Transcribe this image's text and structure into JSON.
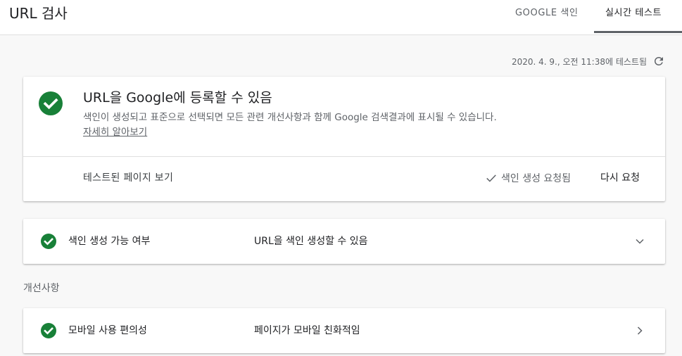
{
  "header": {
    "title": "URL 검사",
    "tabs": [
      {
        "label": "GOOGLE 색인",
        "active": false
      },
      {
        "label": "실시간 테스트",
        "active": true
      }
    ]
  },
  "test_info": {
    "timestamp": "2020. 4. 9., 오전 11:38에 테스트됨",
    "refresh_icon": "refresh-icon"
  },
  "main_card": {
    "status_icon": "check-circle-icon",
    "title": "URL을 Google에 등록할 수 있음",
    "description": "색인이 생성되고 표준으로 선택되면 모든 관련 개선사항과 함께 Google 검색결과에 표시될 수 있습니다.",
    "learn_more": "자세히 알아보기",
    "view_tested_page": "테스트된 페이지 보기",
    "indexing_requested": "색인 생성 요청됨",
    "request_again": "다시 요청"
  },
  "indexability": {
    "label": "색인 생성 가능 여부",
    "status": "URL을 색인 생성할 수 있음",
    "icon": "chevron-down-icon"
  },
  "enhancements": {
    "section_title": "개선사항",
    "items": [
      {
        "label": "모바일 사용 편의성",
        "status": "페이지가 모바일 친화적임",
        "icon": "chevron-right-icon"
      }
    ]
  },
  "colors": {
    "success_green": "#188038",
    "text_primary": "#202124",
    "text_secondary": "#5f6368",
    "background": "#f8f8f8"
  }
}
